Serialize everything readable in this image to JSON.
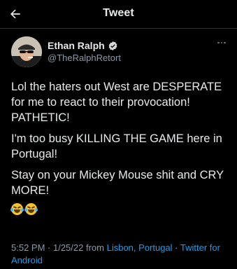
{
  "header": {
    "title": "Tweet",
    "back_icon": "arrow-left-icon"
  },
  "tweet": {
    "author": {
      "display_name": "Ethan Ralph",
      "handle": "@TheRalphRetort",
      "verified_icon": "verified-badge-icon"
    },
    "paragraphs": [
      "Lol the haters out West are DESPERATE for me to react to their provocation! PATHETIC!",
      "I'm too busy KILLING THE GAME here in Portugal!",
      "Stay on your Mickey Mouse shit and CRY MORE!"
    ],
    "emojis": [
      "face-with-tears-of-joy",
      "face-with-tears-of-joy"
    ],
    "meta": {
      "time": "5:52 PM",
      "sep1": " · ",
      "date": "1/25/22",
      "from": " from ",
      "location": "Lisbon, Portugal",
      "sep2": " · ",
      "client": "Twitter for Android"
    }
  },
  "colors": {
    "background": "#000000",
    "text": "#e7e9ea",
    "secondary": "#8b98a5",
    "link": "#1d9bf0",
    "verified": "#d9d9d9"
  }
}
